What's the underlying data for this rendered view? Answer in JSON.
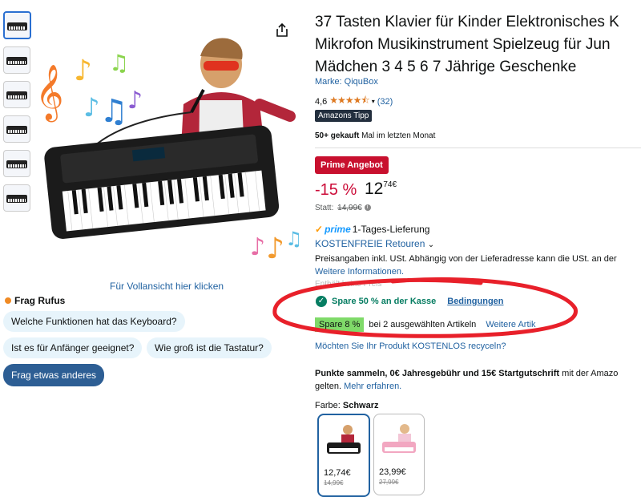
{
  "product": {
    "title_lines": [
      "37 Tasten Klavier für Kinder Elektronisches K",
      "Mikrofon Musikinstrument Spielzeug für Jun",
      "Mädchen 3 4 5 6 7 Jährige Geschenke"
    ],
    "brand": "Marke: QiquBox",
    "rating_value": "4,6",
    "rating_stars": "★★★★⯪",
    "rating_count": "(32)",
    "badge": "Amazons Tipp",
    "bought_bold": "50+ gekauft",
    "bought_rest": " Mal im letzten Monat"
  },
  "gallery": {
    "view_full": "Für Vollansicht hier klicken"
  },
  "rufus": {
    "title": "Frag Rufus",
    "chips": [
      "Welche Funktionen hat das Keyboard?",
      "Ist es für Anfänger geeignet?",
      "Wie groß ist die Tastatur?",
      "Frag etwas anderes"
    ]
  },
  "pricing": {
    "deal_badge": "Prime Angebot",
    "discount": "-15 %",
    "price_whole": "12",
    "price_cents": "74",
    "currency": "€",
    "was_label": "Statt:",
    "was_price": "14,99€",
    "prime_word": "prime",
    "delivery": "1-Tages-Lieferung",
    "returns": "KOSTENFREIE Retouren",
    "tax_note": "Preisangaben inkl. USt. Abhängig von der Lieferadresse kann die USt. an der",
    "more_info": "Weitere Informationen.",
    "obscured_text": "Enthält keine Preis"
  },
  "coupons": {
    "coupon_text": "Spare 50 % an der Kasse",
    "coupon_link": "Bedingungen",
    "promo_tag": "Spare 8 %",
    "promo_text": "bei 2 ausgewählten Artikeln",
    "promo_link": "Weitere Artik",
    "recycle": "Möchten Sie Ihr Produkt KOSTENLOS recyceln?",
    "annotation_color": "#e8202a"
  },
  "points": {
    "bold": "Punkte sammeln, 0€ Jahresgebühr und 15€ Startgutschrift",
    "rest": " mit der Amazo",
    "line2": "gelten. ",
    "link": "Mehr erfahren."
  },
  "variants": {
    "label": "Farbe: ",
    "selected": "Schwarz",
    "items": [
      {
        "price": "12,74€",
        "old": "14,99€"
      },
      {
        "price": "23,99€",
        "old": "27,99€"
      }
    ]
  },
  "colors": {
    "link": "#2162a1",
    "prime_red": "#c8102e",
    "discount_red": "#cc0c39",
    "rufus_chip": "#e7f4fb",
    "rufus_dark": "#2d5e94"
  }
}
